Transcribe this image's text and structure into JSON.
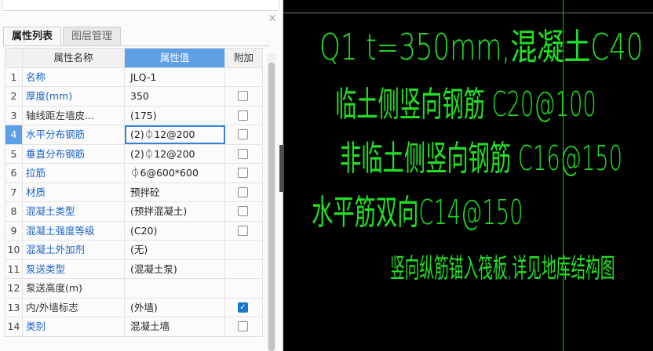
{
  "panel": {
    "tabs": [
      "属性列表",
      "图层管理"
    ],
    "close_icon": "×",
    "headers": {
      "name": "属性名称",
      "value": "属性值",
      "extra": "附加"
    },
    "rows": [
      {
        "idx": "1",
        "name": "名称",
        "value": "JLQ-1",
        "blue": true,
        "check": null
      },
      {
        "idx": "2",
        "name": "厚度(mm)",
        "value": "350",
        "blue": true,
        "check": false
      },
      {
        "idx": "3",
        "name": "轴线距左墙皮...",
        "value": "(175)",
        "blue": false,
        "check": false
      },
      {
        "idx": "4",
        "name": "水平分布钢筋",
        "value": "(2)⏀12@200",
        "blue": true,
        "check": false,
        "selected": true
      },
      {
        "idx": "5",
        "name": "垂直分布钢筋",
        "value": "(2)⏀12@200",
        "blue": true,
        "check": false
      },
      {
        "idx": "6",
        "name": "拉筋",
        "value": "⏀6@600*600",
        "blue": true,
        "check": false
      },
      {
        "idx": "7",
        "name": "材质",
        "value": "预拌砼",
        "blue": true,
        "check": false
      },
      {
        "idx": "8",
        "name": "混凝土类型",
        "value": "(预拌混凝土)",
        "blue": true,
        "check": false
      },
      {
        "idx": "9",
        "name": "混凝土强度等级",
        "value": "(C20)",
        "blue": true,
        "check": false
      },
      {
        "idx": "10",
        "name": "混凝土外加剂",
        "value": "(无)",
        "blue": true,
        "check": null
      },
      {
        "idx": "11",
        "name": "泵送类型",
        "value": "(混凝土泵)",
        "blue": true,
        "check": null
      },
      {
        "idx": "12",
        "name": "泵送高度(m)",
        "value": "",
        "blue": false,
        "check": null
      },
      {
        "idx": "13",
        "name": "内/外墙标志",
        "value": "(外墙)",
        "blue": false,
        "check": true
      },
      {
        "idx": "14",
        "name": "类别",
        "value": "混凝土墙",
        "blue": true,
        "check": false
      }
    ]
  },
  "cad": {
    "line1": "Q1  t=350mm,混凝土C40",
    "line2": "临土侧竖向钢筋  C20@100",
    "line3": "非临土侧竖向钢筋  C16@150",
    "line4": "水平筋双向C14@150",
    "line5": "竖向纵筋锚入筏板,详见地库结构图"
  },
  "colors": {
    "accent": "#5e9fe6",
    "cad_text": "#21e021",
    "cad_bg": "#000000"
  }
}
